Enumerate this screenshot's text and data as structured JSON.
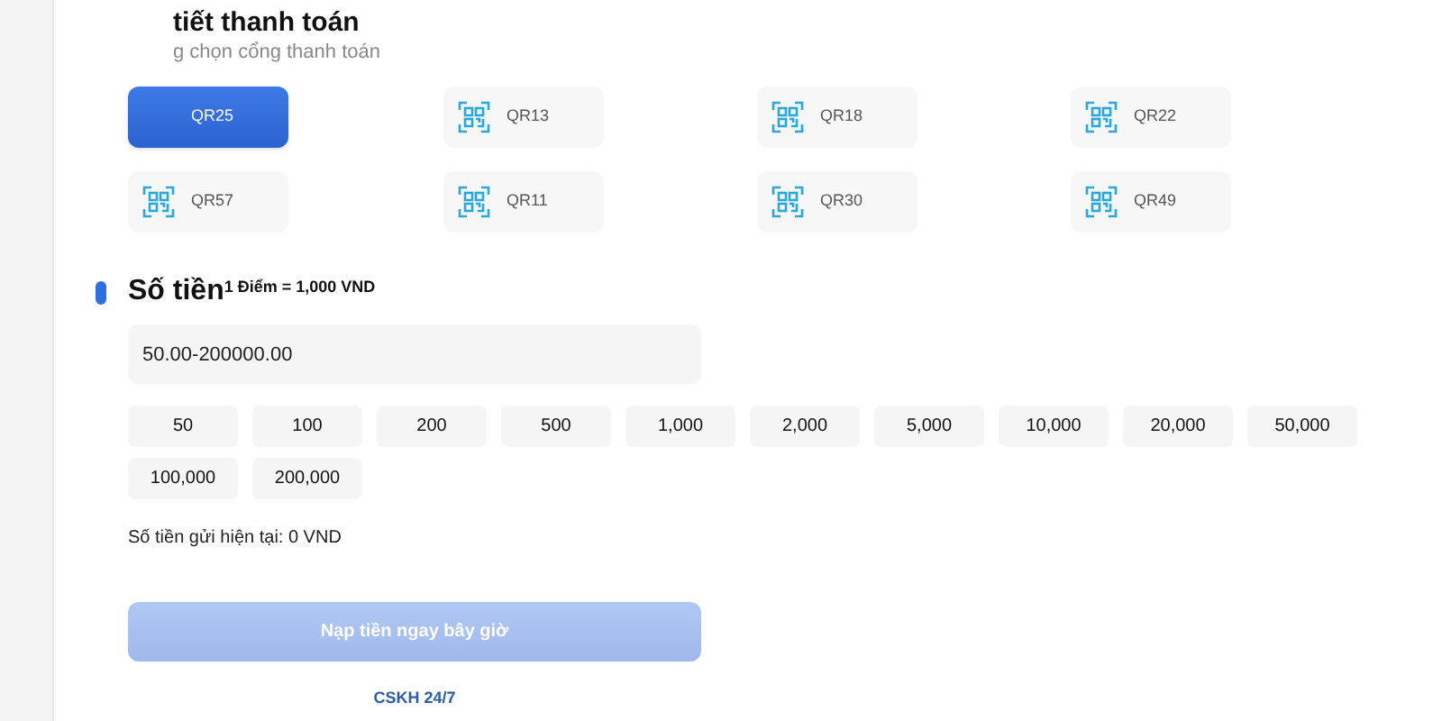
{
  "header": {
    "title": "tiết thanh toán",
    "subtitle": "g chọn cổng thanh toán"
  },
  "gateways": [
    {
      "label": "QR25",
      "selected": true
    },
    {
      "label": "QR13",
      "selected": false
    },
    {
      "label": "QR18",
      "selected": false
    },
    {
      "label": "QR22",
      "selected": false
    },
    {
      "label": "QR57",
      "selected": false
    },
    {
      "label": "QR11",
      "selected": false
    },
    {
      "label": "QR30",
      "selected": false
    },
    {
      "label": "QR49",
      "selected": false
    }
  ],
  "amount": {
    "heading": "Số tiền",
    "rate": "1 Điểm = 1,000 VND",
    "placeholder": "50.00-200000.00",
    "presets": [
      "50",
      "100",
      "200",
      "500",
      "1,000",
      "2,000",
      "5,000",
      "10,000",
      "20,000",
      "50,000",
      "100,000",
      "200,000"
    ],
    "current": "Số tiền gửi hiện tại: 0 VND"
  },
  "submit": {
    "label": "Nạp tiền ngay bây giờ",
    "disabled": true
  },
  "support_link": "CSKH 24/7"
}
